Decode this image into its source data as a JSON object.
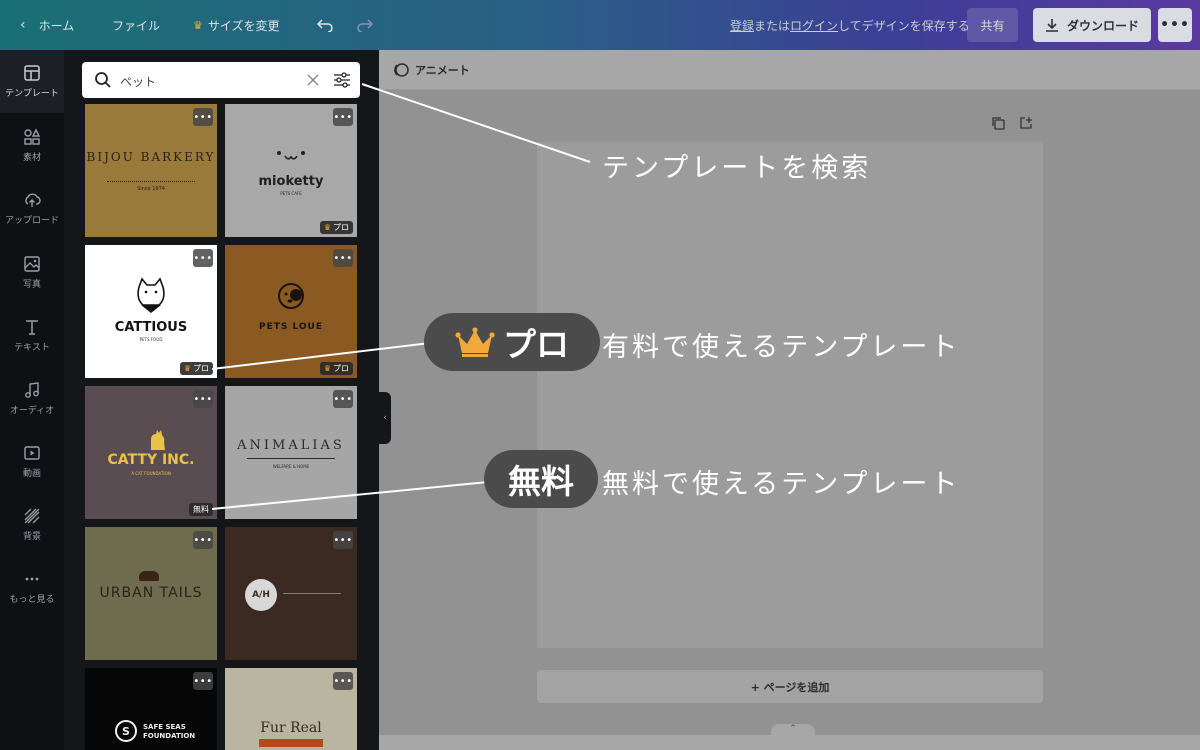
{
  "topbar": {
    "home": "ホーム",
    "file": "ファイル",
    "resize": "サイズを変更",
    "save_link_register": "登録",
    "save_or": "または",
    "save_link_login": "ログイン",
    "save_suffix": "してデザインを保存する",
    "share": "共有",
    "download": "ダウンロード",
    "more": "•••"
  },
  "rail": {
    "items": [
      {
        "label": "テンプレート",
        "icon": "template-icon"
      },
      {
        "label": "素材",
        "icon": "elements-icon"
      },
      {
        "label": "アップロード",
        "icon": "upload-icon"
      },
      {
        "label": "写真",
        "icon": "photo-icon"
      },
      {
        "label": "テキスト",
        "icon": "text-icon"
      },
      {
        "label": "オーディオ",
        "icon": "audio-icon"
      },
      {
        "label": "動画",
        "icon": "video-icon"
      },
      {
        "label": "背景",
        "icon": "background-icon"
      },
      {
        "label": "もっと見る",
        "icon": "more-icon"
      }
    ]
  },
  "search": {
    "value": "ペット"
  },
  "templates": [
    {
      "title": "BIJOU BARKERY",
      "sub": "Since 1974",
      "badge": ""
    },
    {
      "title": "mioketty",
      "sub": "PETS CAFE",
      "badge": "プロ"
    },
    {
      "title": "CATTIOUS",
      "sub": "PETS FOOD",
      "badge": "プロ"
    },
    {
      "title": "PETS LOUE",
      "sub": "",
      "badge": "プロ"
    },
    {
      "title": "CATTY INC.",
      "sub": "A CAT FOUNDATION",
      "badge": "無料"
    },
    {
      "title": "ANIMALIAS",
      "sub": "WELFARE & HOME",
      "badge": ""
    },
    {
      "title": "URBAN TAILS",
      "sub": "",
      "badge": ""
    },
    {
      "title": "A/H",
      "sub": "",
      "badge": ""
    },
    {
      "title": "SAFE SEAS FOUNDATION",
      "sub": "",
      "badge": ""
    },
    {
      "title": "Fur Real",
      "sub": "",
      "badge": ""
    }
  ],
  "editor": {
    "animate": "アニメート",
    "add_page": "+ ページを追加"
  },
  "callouts": {
    "search": "テンプレートを検索",
    "pro_pill": "プロ",
    "pro_text": "有料で使えるテンプレート",
    "free_pill": "無料",
    "free_text": "無料で使えるテンプレート"
  },
  "colors": {
    "pro_crown": "#f2a93b",
    "topbar_start": "#1a6f74",
    "topbar_end": "#5a3aa0"
  }
}
